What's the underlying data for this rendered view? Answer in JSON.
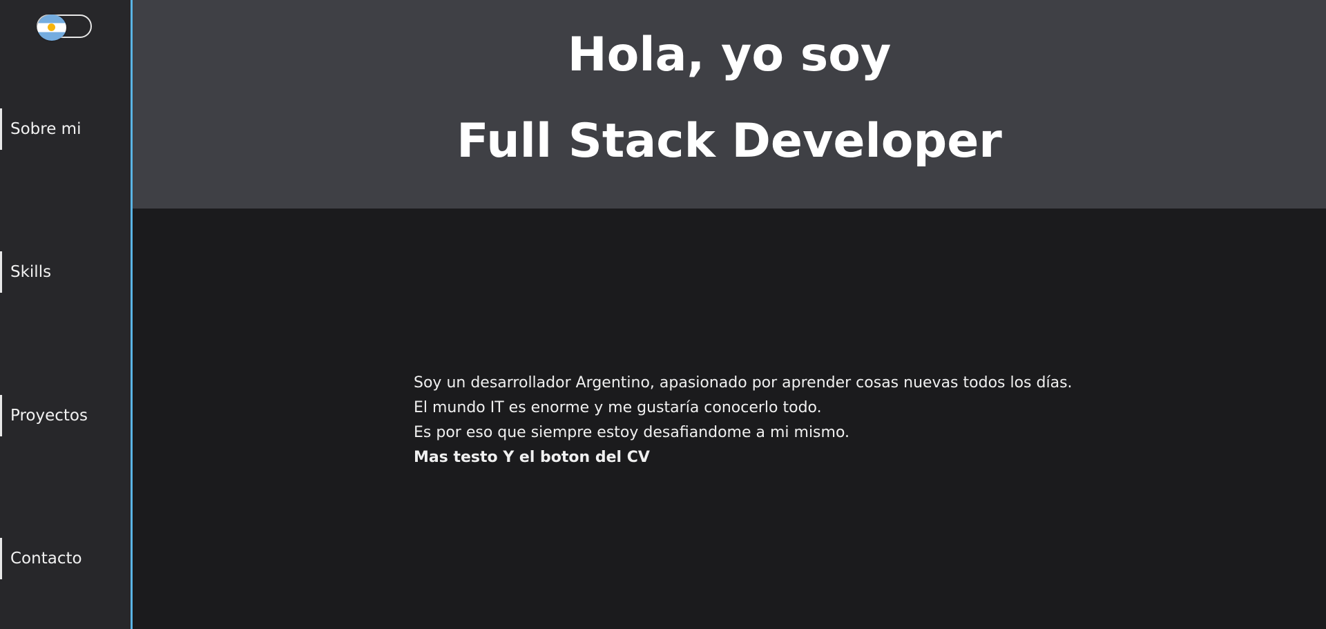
{
  "sidebar": {
    "items": [
      {
        "label": "Sobre mi"
      },
      {
        "label": "Skills"
      },
      {
        "label": "Proyectos"
      },
      {
        "label": "Contacto"
      }
    ],
    "language_toggle": {
      "icon": "argentina-flag-icon"
    }
  },
  "hero": {
    "line1": "Hola, yo soy",
    "line2": "Full Stack Developer"
  },
  "about": {
    "lines": [
      "Soy un desarrollador Argentino, apasionado por aprender cosas nuevas todos los días.",
      "El mundo IT es enorme y me gustaría conocerlo todo.",
      "Es por eso que siempre estoy desafiandome a mi mismo."
    ],
    "highlight": "Mas testo Y el boton del CV"
  },
  "colors": {
    "sidebar_bg": "#27272a",
    "sidebar_border": "#5ab4e5",
    "hero_bg": "#3f4045",
    "page_bg": "#1b1b1d",
    "text": "#ffffff"
  }
}
